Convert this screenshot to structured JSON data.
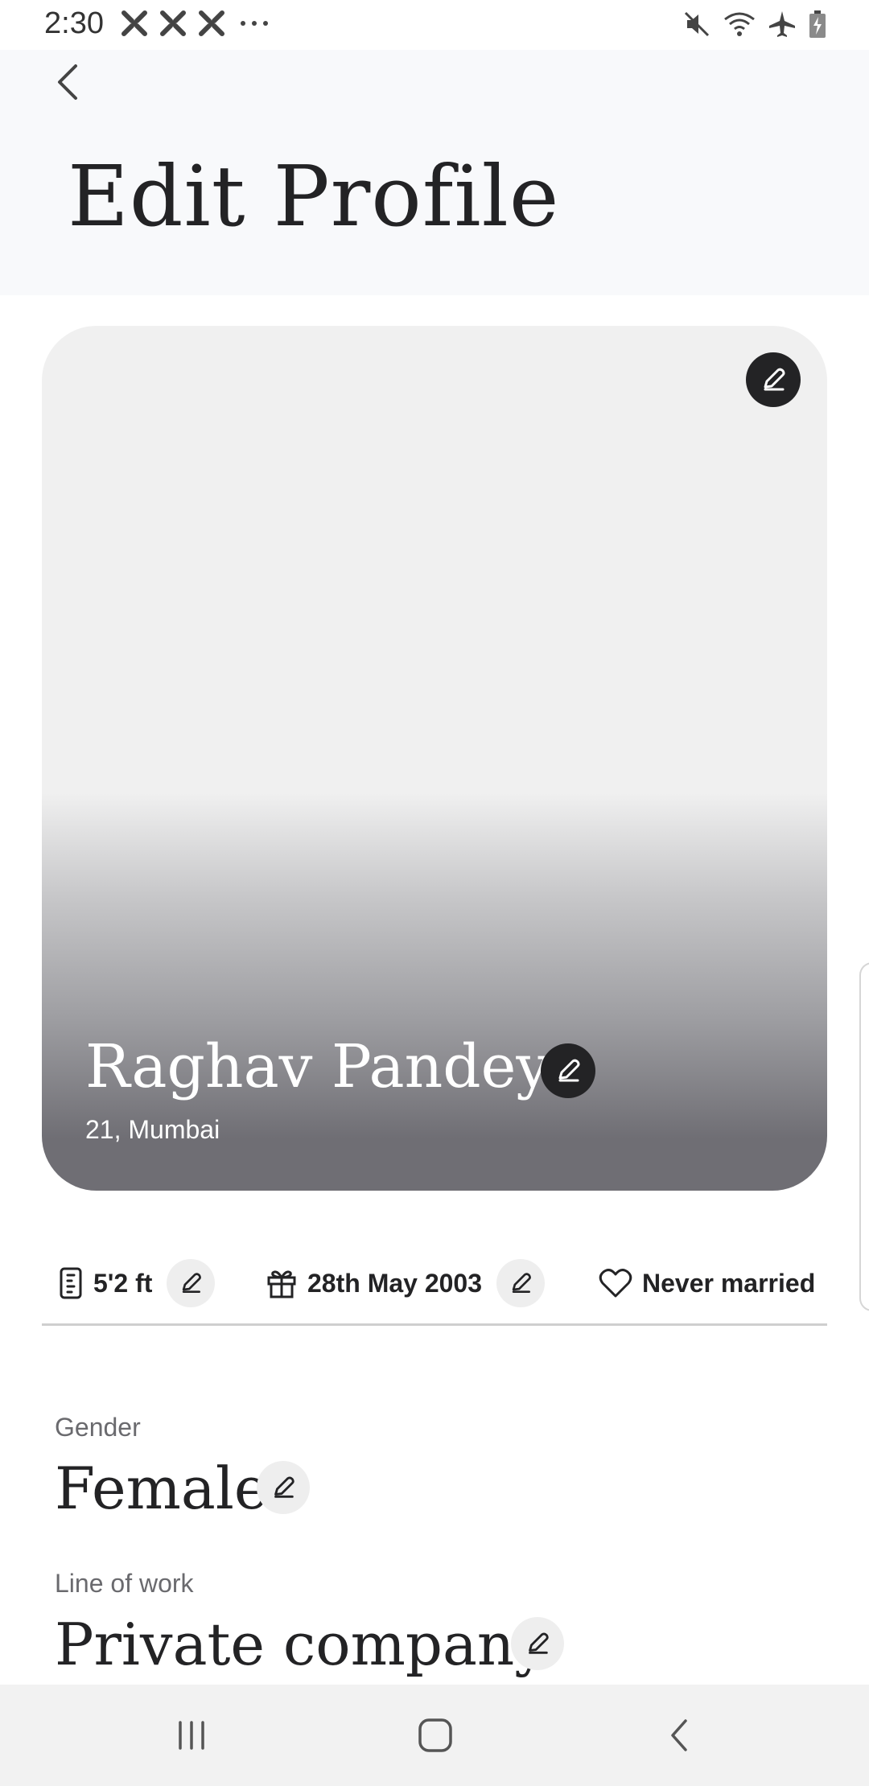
{
  "status_bar": {
    "time": "2:30",
    "left_icons": [
      "x-notification-icon",
      "x-notification-icon",
      "x-notification-icon",
      "more-notifications-icon"
    ],
    "right_icons": [
      "mute-icon",
      "wifi-icon",
      "airplane-mode-icon",
      "battery-charging-icon"
    ]
  },
  "header": {
    "title": "Edit Profile"
  },
  "profile_card": {
    "name": "Raghav Pandey",
    "subtitle": "21, Mumbai"
  },
  "chips": [
    {
      "icon": "height-ruler-icon",
      "label": "5'2 ft"
    },
    {
      "icon": "gift-icon",
      "label": "28th May 2003"
    },
    {
      "icon": "heart-icon",
      "label": "Never married"
    }
  ],
  "fields": [
    {
      "label": "Gender",
      "value": "Female"
    },
    {
      "label": "Line of work",
      "value": "Private company"
    }
  ],
  "nav_bar": {
    "buttons": [
      "recent-apps-icon",
      "home-icon",
      "back-icon"
    ]
  }
}
